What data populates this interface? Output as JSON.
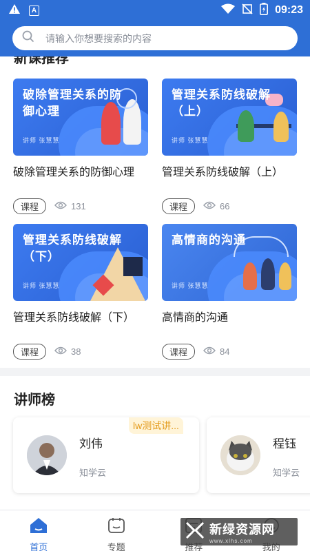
{
  "status_bar": {
    "time": "09:23",
    "a_icon_label": "A"
  },
  "search": {
    "placeholder": "请输入你想要搜索的内容"
  },
  "courses_section": {
    "title": "新课推荐"
  },
  "courses": [
    {
      "thumb_title": "破除管理关系的防御心理",
      "thumb_tag": "讲师  张慧慧",
      "name": "破除管理关系的防御心理",
      "tag": "课程",
      "views": "131"
    },
    {
      "thumb_title": "管理关系防线破解（上）",
      "thumb_tag": "讲师  张慧慧",
      "name": "管理关系防线破解（上）",
      "tag": "课程",
      "views": "66"
    },
    {
      "thumb_title": "管理关系防线破解（下）",
      "thumb_tag": "讲师  张慧慧",
      "name": "管理关系防线破解（下）",
      "tag": "课程",
      "views": "38"
    },
    {
      "thumb_title": "高情商的沟通",
      "thumb_tag": "讲师  张慧慧",
      "name": "高情商的沟通",
      "tag": "课程",
      "views": "84"
    }
  ],
  "teachers_section": {
    "title": "讲师榜"
  },
  "teachers": [
    {
      "name": "刘伟",
      "org": "知学云",
      "badge": "lw测试讲..."
    },
    {
      "name": "程钰",
      "org": "知学云"
    }
  ],
  "bottom_nav": [
    {
      "label": "首页",
      "icon": "home-icon",
      "active": true
    },
    {
      "label": "专题",
      "icon": "topic-icon"
    },
    {
      "label": "推荐",
      "icon": "recommend-icon"
    },
    {
      "label": "我的",
      "icon": "profile-icon"
    }
  ],
  "watermark": {
    "text": "新绿资源网",
    "sub": "www.xlhs.com"
  },
  "colors": {
    "primary": "#2e6fd6",
    "badge_text": "#e39a1a",
    "badge_bg": "#fff4d8"
  }
}
